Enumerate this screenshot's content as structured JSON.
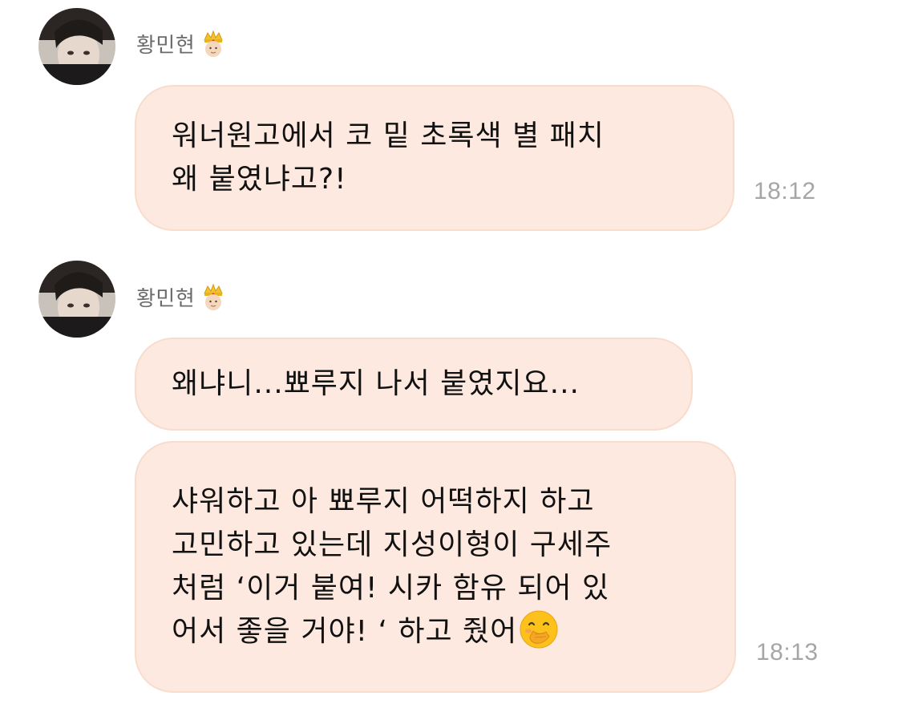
{
  "colors": {
    "bubble_bg": "#fde9df",
    "bubble_border": "#f8dccd",
    "sender_name": "#6b6b6b",
    "timestamp": "#a6a6a6",
    "text": "#111111"
  },
  "messages": [
    {
      "sender": "황민현",
      "sender_icon": "crown-prince-emoji-icon",
      "bubbles": [
        {
          "text": "워너원고에서 코 밑 초록색 별 패치\n왜 붙였냐고?!",
          "time": "18:12"
        }
      ]
    },
    {
      "sender": "황민현",
      "sender_icon": "crown-prince-emoji-icon",
      "bubbles": [
        {
          "text": "왜냐니...뾰루지 나서 붙였지요..."
        },
        {
          "text": "샤워하고 아 뾰루지 어떡하지 하고\n고민하고 있는데 지성이형이 구세주\n처럼 ‘이거 붙여! 시카 함유 되어 있\n어서 좋을 거야! ‘ 하고 줬어",
          "trailing_icon": "face-with-hand-over-mouth-emoji-icon",
          "time": "18:13"
        }
      ]
    }
  ]
}
